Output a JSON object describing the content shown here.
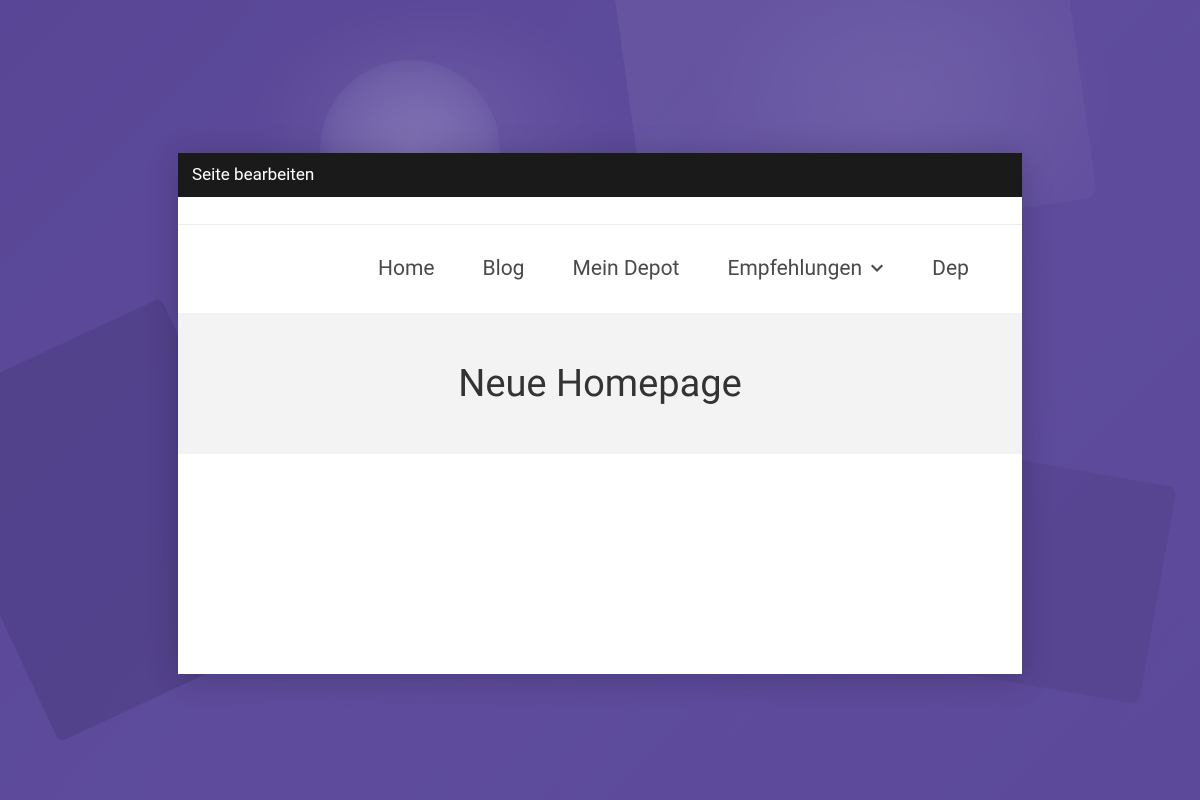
{
  "admin_bar": {
    "label": "Seite bearbeiten"
  },
  "nav": {
    "items": [
      {
        "label": "Home",
        "has_dropdown": false
      },
      {
        "label": "Blog",
        "has_dropdown": false
      },
      {
        "label": "Mein Depot",
        "has_dropdown": false
      },
      {
        "label": "Empfehlungen",
        "has_dropdown": true
      },
      {
        "label": "Dep",
        "has_dropdown": false
      }
    ]
  },
  "page": {
    "title": "Neue Homepage"
  }
}
